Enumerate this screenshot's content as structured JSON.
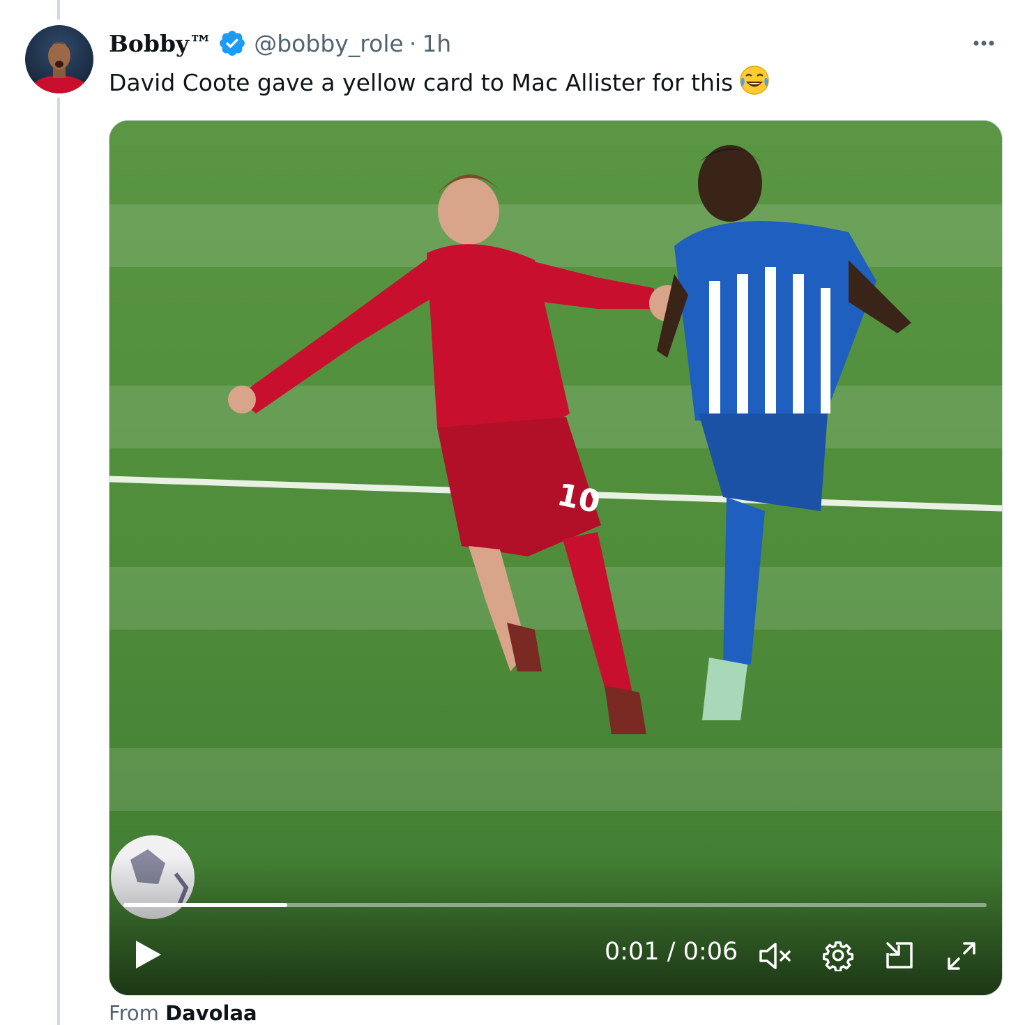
{
  "tweet": {
    "display_name": "Bobby™",
    "handle": "@bobby_role",
    "separator": "·",
    "time_ago": "1h",
    "text": "David Coote gave a yellow card to Mac Allister for this",
    "emoji": "face-with-tears-of-joy",
    "verified": true
  },
  "video": {
    "elapsed": "0:01",
    "time_divider": "/",
    "duration": "0:06",
    "progress_fraction": 0.19,
    "muted": true
  },
  "source": {
    "prefix": "From",
    "name": "Davolaa"
  },
  "icons": {
    "more": "more-horizontal-icon",
    "play": "play-icon",
    "mute": "volume-muted-icon",
    "settings": "settings-gear-icon",
    "pip": "picture-in-picture-icon",
    "fullscreen": "fullscreen-icon"
  },
  "colors": {
    "verified_blue": "#1d9bf0",
    "handle_gray": "#536471",
    "pitch_green": "#4d8a3a",
    "liverpool_red": "#c8102e",
    "brighton_blue": "#1f5fbf"
  }
}
